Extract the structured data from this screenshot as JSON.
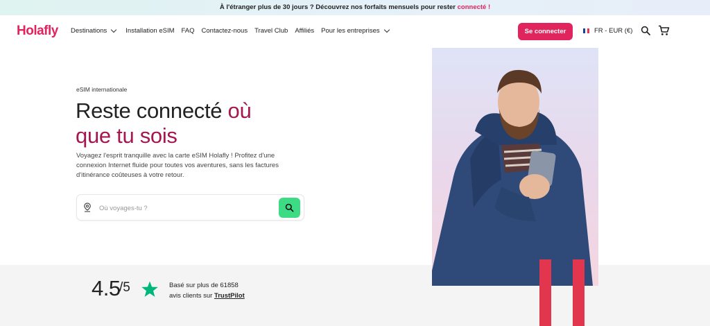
{
  "promo": {
    "text": "À l'étranger plus de 30 jours ? Découvrez nos forfaits mensuels pour rester",
    "highlight": "connecté",
    "suffix": "!"
  },
  "header": {
    "logo": "Holafly",
    "nav": [
      {
        "label": "Destinations",
        "dropdown": true
      },
      {
        "label": "Installation eSIM",
        "dropdown": false
      },
      {
        "label": "FAQ",
        "dropdown": false
      },
      {
        "label": "Contactez-nous",
        "dropdown": false
      },
      {
        "label": "Travel Club",
        "dropdown": false
      },
      {
        "label": "Affiliés",
        "dropdown": false
      },
      {
        "label": "Pour les entreprises",
        "dropdown": true
      }
    ],
    "login_label": "Se connecter",
    "locale_label": "FR - EUR (€)",
    "icons": [
      "search-icon",
      "cart-icon"
    ]
  },
  "hero": {
    "badge": "eSIM internationale",
    "headline_dark": "Reste connecté",
    "headline_pink_1": "où",
    "headline_pink_2": "que tu sois",
    "description": "Voyagez l'esprit tranquille avec la carte eSIM Holafly ! Profitez d'une connexion Internet fluide pour toutes vos aventures, sans les factures d'itinérance coûteuses à votre retour.",
    "search_placeholder": "Où voyages-tu ?"
  },
  "rating": {
    "score": "4.5",
    "out_of": "/5",
    "line1": "Basé sur plus de 61858",
    "line2_prefix": "avis clients sur",
    "provider": "TrustPilot"
  },
  "colors": {
    "brand": "#e0245e",
    "headline_accent": "#a4184f",
    "search_button": "#3ddc84",
    "trustpilot_star": "#00b67a",
    "accent_bars": "#e2364f"
  }
}
